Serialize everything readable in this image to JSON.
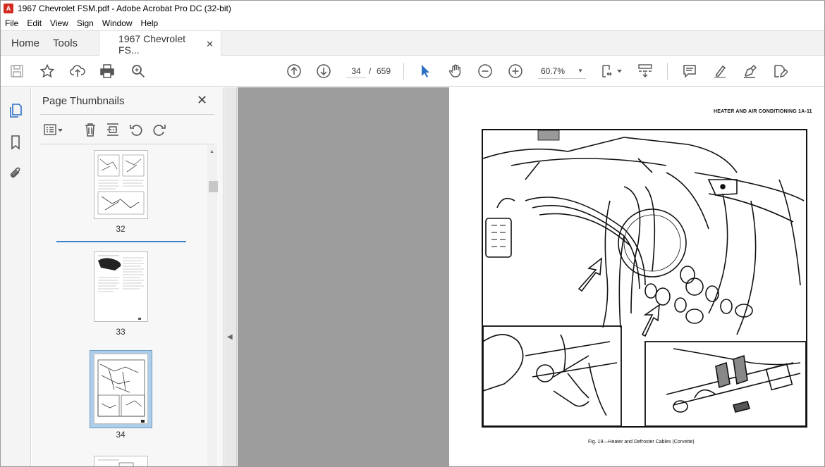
{
  "window": {
    "title": "1967 Chevrolet FSM.pdf - Adobe Acrobat Pro DC (32-bit)"
  },
  "menu": [
    "File",
    "Edit",
    "View",
    "Sign",
    "Window",
    "Help"
  ],
  "tabs": {
    "home": "Home",
    "tools": "Tools",
    "document": "1967 Chevrolet FS..."
  },
  "toolbar": {
    "current_page": "34",
    "separator": "/",
    "total_pages": "659",
    "zoom": "60.7%",
    "icons": [
      "save-icon",
      "star-icon",
      "upload-icon",
      "print-icon",
      "search-icon",
      "page-up-icon",
      "page-down-icon",
      "select-arrow-icon",
      "hand-icon",
      "zoom-out-icon",
      "zoom-in-icon",
      "fit-page-icon",
      "scroll-mode-icon",
      "comment-icon",
      "highlight-icon",
      "sign-icon",
      "more-tools-icon"
    ]
  },
  "sidebar": {
    "title": "Page Thumbnails",
    "thumbnails": [
      {
        "label": "32"
      },
      {
        "label": "33"
      },
      {
        "label": "34",
        "selected": true
      }
    ]
  },
  "document_page": {
    "header": "HEATER AND AIR CONDITIONING 1A-11",
    "caption": "Fig. 19—Heater and Defroster Cables (Corvette)"
  }
}
